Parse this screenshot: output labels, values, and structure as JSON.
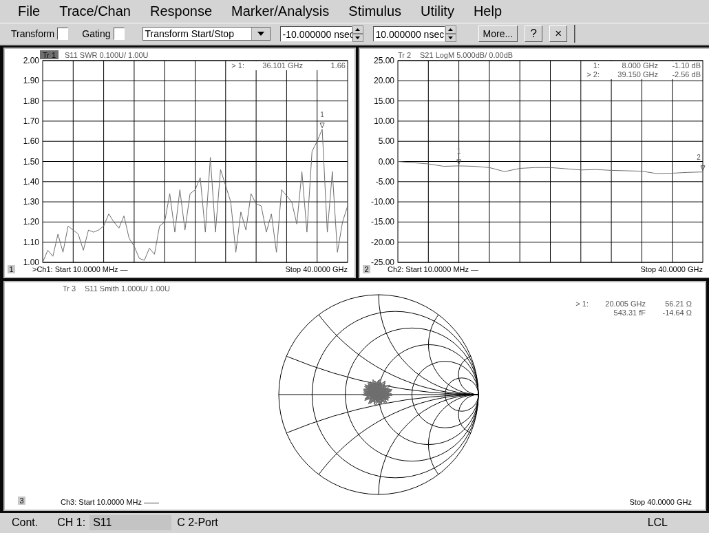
{
  "menu": [
    "File",
    "Trace/Chan",
    "Response",
    "Marker/Analysis",
    "Stimulus",
    "Utility",
    "Help"
  ],
  "toolbar": {
    "transform": {
      "label": "Transform",
      "checked": false
    },
    "gating": {
      "label": "Gating",
      "checked": false
    },
    "mode": {
      "value": "Transform Start/Stop"
    },
    "start": {
      "value": "-10.000000 nsec"
    },
    "stop": {
      "value": "10.000000 nsec"
    },
    "more": "More...",
    "help": "?",
    "close": "×"
  },
  "traces": [
    {
      "kind": "cartesian",
      "number": "1",
      "tag": "Tr 1",
      "selected": true,
      "header": "S11 SWR 0.100U/  1.00U",
      "readouts": [
        {
          "label": "> 1:",
          "freq": "36.101 GHz",
          "value": "1.66"
        }
      ],
      "start": ">Ch1: Start  10.0000 MHz —",
      "stop": "Stop  40.0000 GHz",
      "chart_data": {
        "type": "line",
        "categories": [
          null,
          null,
          null,
          null,
          null,
          null,
          null,
          null,
          null,
          null,
          null,
          null,
          null,
          null,
          null,
          null,
          null,
          null,
          null,
          null,
          null,
          null,
          null,
          null,
          null,
          null,
          null,
          null,
          null,
          null,
          null,
          null,
          null,
          null,
          null,
          null,
          null,
          null,
          null,
          null,
          null,
          null,
          null,
          null,
          null,
          null,
          null,
          null,
          null,
          null,
          null,
          null,
          null,
          null,
          null,
          null,
          null,
          null,
          null,
          null,
          null
        ],
        "ylim": [
          1,
          2
        ],
        "yticks": [
          {
            "value": 2,
            "label": "2.00"
          },
          {
            "value": 1.9,
            "label": "1.90"
          },
          {
            "value": 1.8,
            "label": "1.80"
          },
          {
            "value": 1.7,
            "label": "1.70"
          },
          {
            "value": 1.6,
            "label": "1.60"
          },
          {
            "value": 1.5,
            "label": "1.50"
          },
          {
            "value": 1.4,
            "label": "1.40"
          },
          {
            "value": 1.3,
            "label": "1.30"
          },
          {
            "value": 1.2,
            "label": "1.20"
          },
          {
            "value": 1.1,
            "label": "1.10"
          },
          {
            "value": 1.0,
            "label": "1.00"
          }
        ],
        "series": [
          {
            "color": "#6e6e6e",
            "values": [
              1.0,
              1.06,
              1.03,
              1.14,
              1.05,
              1.18,
              1.16,
              1.14,
              1.06,
              1.16,
              1.15,
              1.16,
              1.18,
              1.24,
              1.2,
              1.17,
              1.23,
              1.12,
              1.08,
              1.02,
              1.01,
              1.07,
              1.04,
              1.18,
              1.2,
              1.34,
              1.15,
              1.36,
              1.16,
              1.34,
              1.36,
              1.42,
              1.15,
              1.52,
              1.15,
              1.46,
              1.38,
              1.3,
              1.05,
              1.25,
              1.16,
              1.34,
              1.29,
              1.28,
              1.15,
              1.24,
              1.05,
              1.36,
              1.33,
              1.3,
              1.19,
              1.45,
              1.15,
              1.55,
              1.6,
              1.66,
              1.15,
              1.45,
              1.05,
              1.2,
              1.28
            ]
          }
        ],
        "grid": true,
        "annotations": [
          {
            "y": 1.66,
            "text": "1"
          }
        ]
      }
    },
    {
      "kind": "cartesian",
      "number": "2",
      "tag": "Tr 2",
      "selected": false,
      "header": "S21 LogM 5.000dB/  0.00dB",
      "readouts": [
        {
          "label": "1:",
          "freq": "8.000 GHz",
          "value": "-1.10 dB"
        },
        {
          "label": "> 2:",
          "freq": "39.150 GHz",
          "value": "-2.56 dB"
        }
      ],
      "start": "Ch2: Start  10.0000 MHz —",
      "stop": "Stop  40.0000 GHz",
      "chart_data": {
        "type": "line",
        "categories": [
          null,
          null,
          null,
          null,
          null,
          null,
          null,
          null,
          null,
          null,
          null,
          null,
          null,
          null,
          null,
          null,
          null,
          null,
          null,
          null,
          null
        ],
        "ylim": [
          -25,
          25
        ],
        "yticks": [
          {
            "value": 25,
            "label": "25.00"
          },
          {
            "value": 20,
            "label": "20.00"
          },
          {
            "value": 15,
            "label": "15.00"
          },
          {
            "value": 10,
            "label": "10.00"
          },
          {
            "value": 5,
            "label": "5.00"
          },
          {
            "value": 0,
            "label": "0.00"
          },
          {
            "value": -5,
            "label": "-5.00"
          },
          {
            "value": -10,
            "label": "-10.00"
          },
          {
            "value": -15,
            "label": "-15.00"
          },
          {
            "value": -20,
            "label": "-20.00"
          },
          {
            "value": -25,
            "label": "-25.00"
          }
        ],
        "series": [
          {
            "color": "#6e6e6e",
            "values": [
              0,
              -0.3,
              -0.6,
              -1.2,
              -1.1,
              -1.2,
              -1.5,
              -2.5,
              -1.7,
              -1.5,
              -1.5,
              -1.8,
              -2.1,
              -2.0,
              -2.2,
              -2.3,
              -2.4,
              -3.0,
              -2.9,
              -2.7,
              -2.6
            ]
          }
        ],
        "grid": true,
        "annotations": [
          {
            "y": -1.1,
            "text": "1"
          },
          {
            "y": -2.6,
            "text": "2"
          }
        ]
      }
    },
    {
      "kind": "smith",
      "number": "3",
      "tag": "Tr 3",
      "selected": false,
      "header": "S11 Smith 1.000U/  1.00U",
      "readouts": [
        {
          "label": "> 1:",
          "freq": "20.005 GHz",
          "value": "56.21 Ω"
        },
        {
          "freq": "543.31 fF",
          "value": "-14.64 Ω"
        }
      ],
      "start": "Ch3: Start  10.0000 MHz ——",
      "stop": "Stop  40.0000 GHz"
    }
  ],
  "status": {
    "mode": "Cont.",
    "channel": "CH 1:",
    "param": "S11",
    "cal": "C  2-Port",
    "remote": "LCL"
  }
}
